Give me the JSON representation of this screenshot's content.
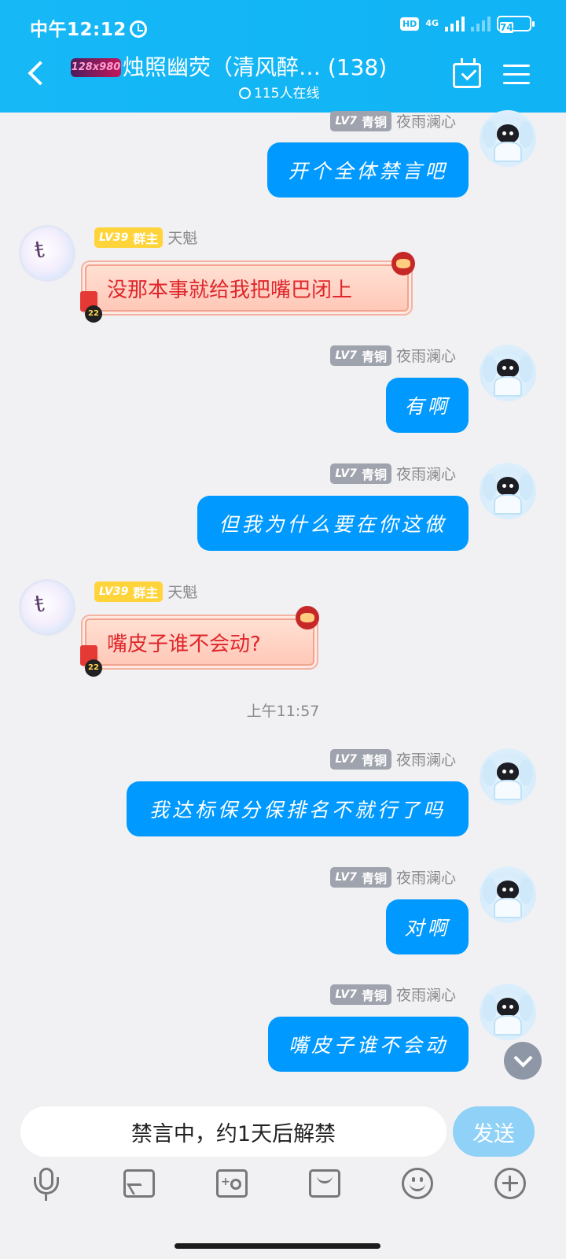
{
  "status_bar": {
    "time": "中午12:12",
    "hd": "HD",
    "network": "4G",
    "battery": "74"
  },
  "header": {
    "group_badge": "128x980",
    "title": "烛照幽荧（清风醉…  (138)",
    "online": "115人在线"
  },
  "messages": [
    {
      "side": "out",
      "level": "LV7",
      "role": "青铜",
      "name": "夜雨澜心",
      "text": "开个全体禁言吧"
    },
    {
      "side": "in",
      "level": "LV39",
      "role": "群主",
      "name": "天魁",
      "text": "没那本事就给我把嘴巴闭上"
    },
    {
      "side": "out",
      "level": "LV7",
      "role": "青铜",
      "name": "夜雨澜心",
      "text": "有啊"
    },
    {
      "side": "out",
      "level": "LV7",
      "role": "青铜",
      "name": "夜雨澜心",
      "text": "但我为什么要在你这做"
    },
    {
      "side": "in",
      "level": "LV39",
      "role": "群主",
      "name": "天魁",
      "text": "嘴皮子谁不会动?"
    },
    {
      "side": "out",
      "level": "LV7",
      "role": "青铜",
      "name": "夜雨澜心",
      "text": "我达标保分保排名不就行了吗"
    },
    {
      "side": "out",
      "level": "LV7",
      "role": "青铜",
      "name": "夜雨澜心",
      "text": "对啊"
    },
    {
      "side": "out",
      "level": "LV7",
      "role": "青铜",
      "name": "夜雨澜心",
      "text": "嘴皮子谁不会动"
    }
  ],
  "time_separator": "上午11:57",
  "input": {
    "muted_text": "禁言中，约1天后解禁",
    "send_label": "发送"
  },
  "toolbar": [
    "mic-icon",
    "image-icon",
    "camera-icon",
    "red-packet-icon",
    "emoji-icon",
    "plus-icon"
  ],
  "colors": {
    "header": "#12b5f4",
    "outgoing_bubble": "#0099ff",
    "incoming_text": "#e0262b",
    "send_button": "#8fd1f7"
  }
}
